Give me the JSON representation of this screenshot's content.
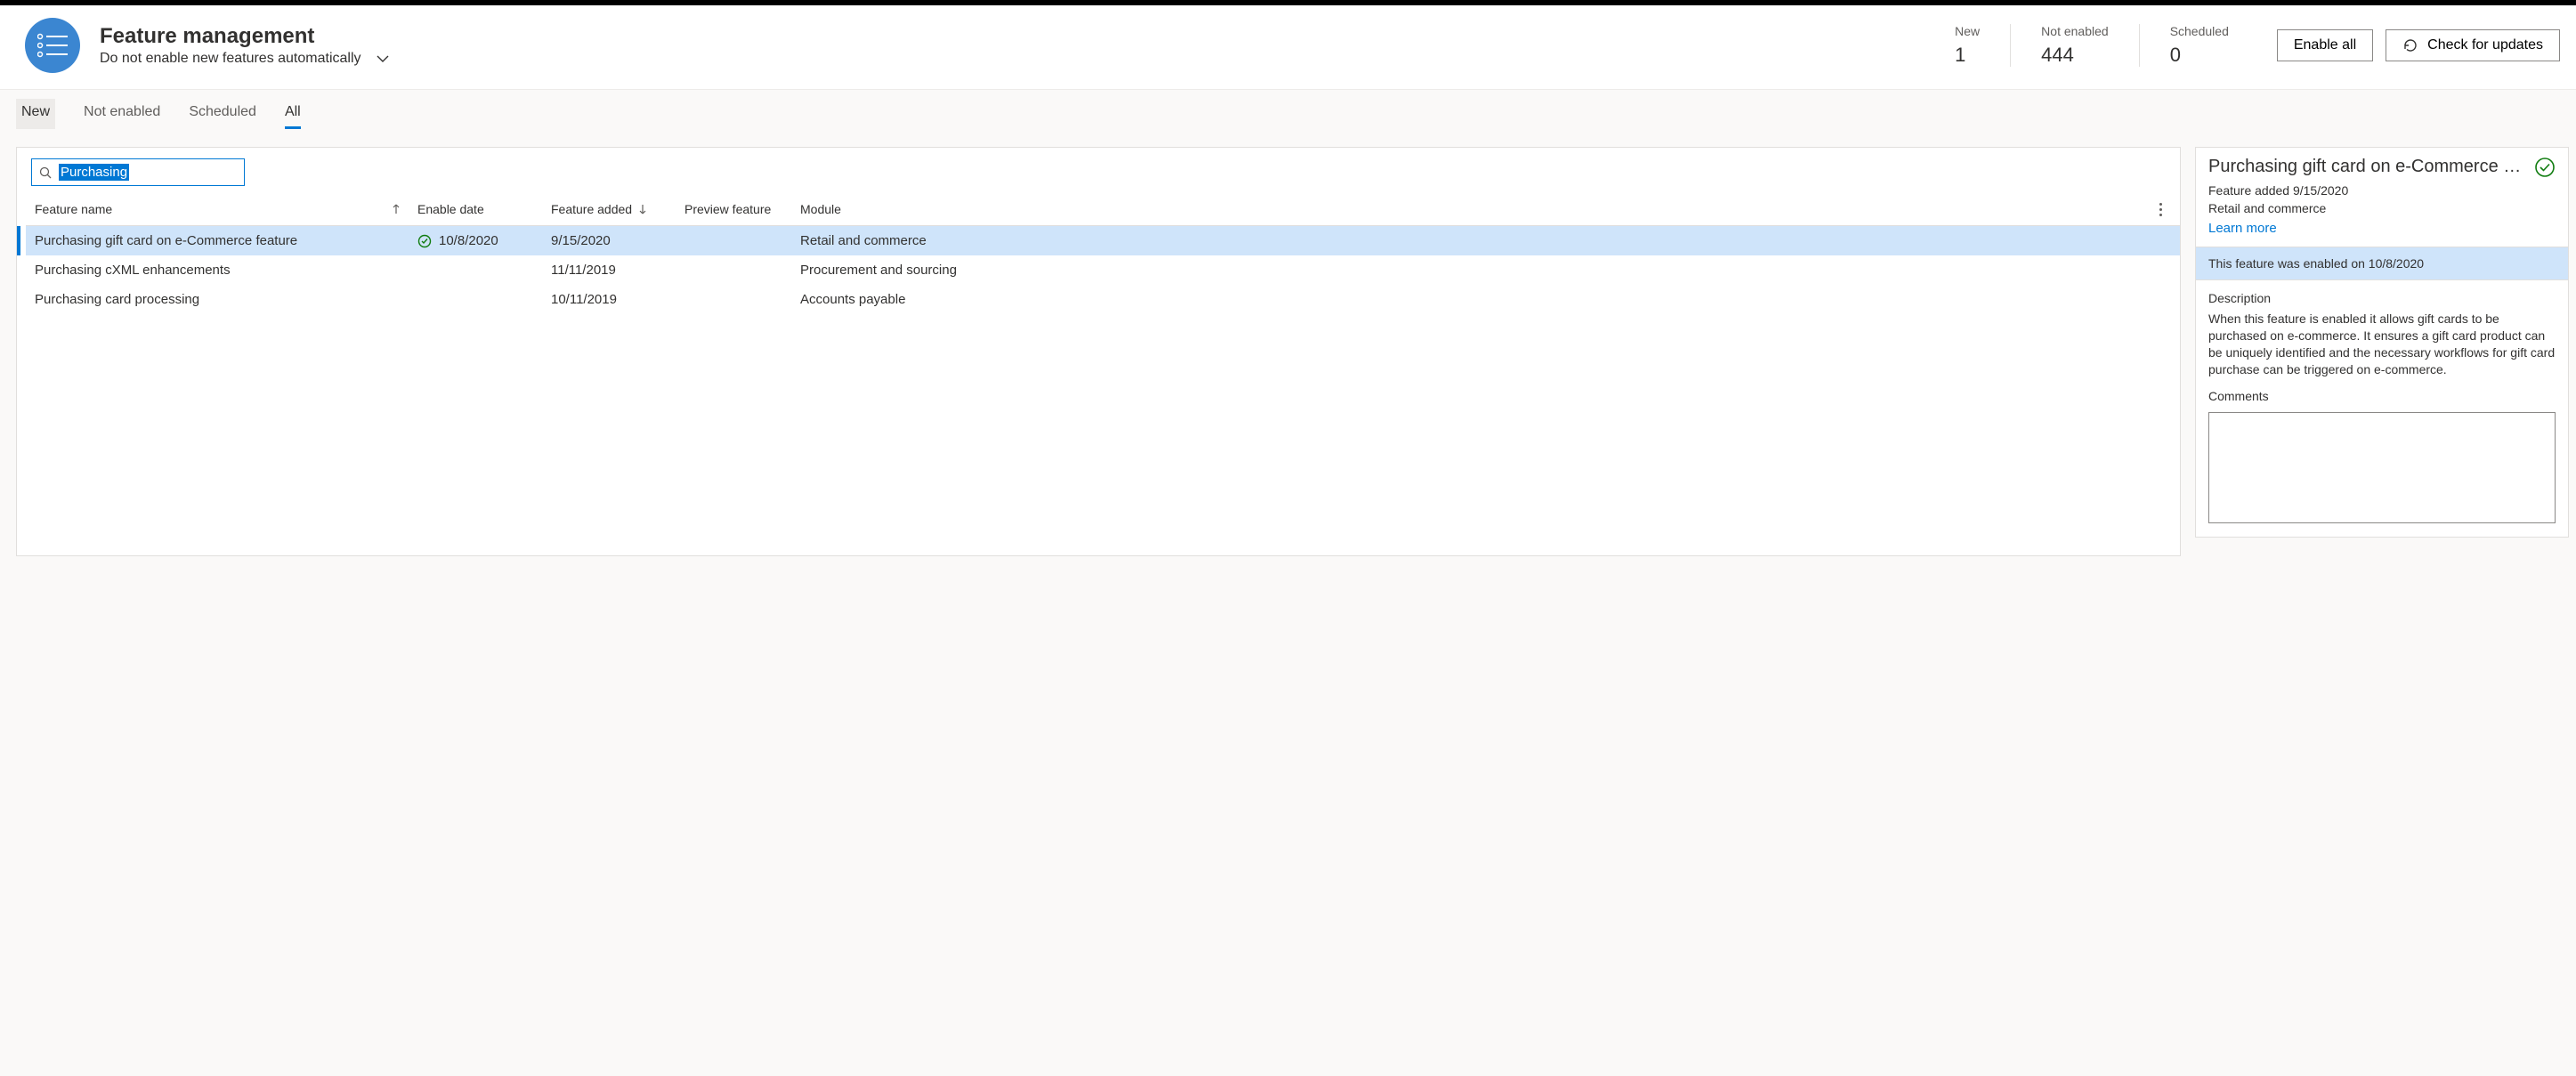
{
  "header": {
    "title": "Feature management",
    "subtitle": "Do not enable new features automatically",
    "stats": [
      {
        "label": "New",
        "value": "1"
      },
      {
        "label": "Not enabled",
        "value": "444"
      },
      {
        "label": "Scheduled",
        "value": "0"
      }
    ],
    "buttons": {
      "enable_all": "Enable all",
      "check_updates": "Check for updates"
    }
  },
  "tabs": {
    "new": "New",
    "not_enabled": "Not enabled",
    "scheduled": "Scheduled",
    "all": "All"
  },
  "filter": {
    "value": "Purchasing"
  },
  "columns": {
    "feature_name": "Feature name",
    "enable_date": "Enable date",
    "feature_added": "Feature added",
    "preview": "Preview feature",
    "module": "Module"
  },
  "rows": [
    {
      "name": "Purchasing gift card on e-Commerce feature",
      "enabled": true,
      "enable_date": "10/8/2020",
      "added": "9/15/2020",
      "preview": "",
      "module": "Retail and commerce"
    },
    {
      "name": "Purchasing cXML enhancements",
      "enabled": false,
      "enable_date": "",
      "added": "11/11/2019",
      "preview": "",
      "module": "Procurement and sourcing"
    },
    {
      "name": "Purchasing card processing",
      "enabled": false,
      "enable_date": "",
      "added": "10/11/2019",
      "preview": "",
      "module": "Accounts payable"
    }
  ],
  "detail": {
    "title": "Purchasing gift card on e-Commerce f…",
    "added_line": "Feature added 9/15/2020",
    "module": "Retail and commerce",
    "learn_more": "Learn more",
    "enabled_banner": "This feature was enabled on 10/8/2020",
    "desc_label": "Description",
    "desc_text": "When this feature is enabled it allows gift cards to be purchased on e-commerce. It ensures a gift card product can be uniquely identified and the necessary workflows for gift card purchase can be triggered on e-commerce.",
    "comments_label": "Comments",
    "comments_value": ""
  }
}
